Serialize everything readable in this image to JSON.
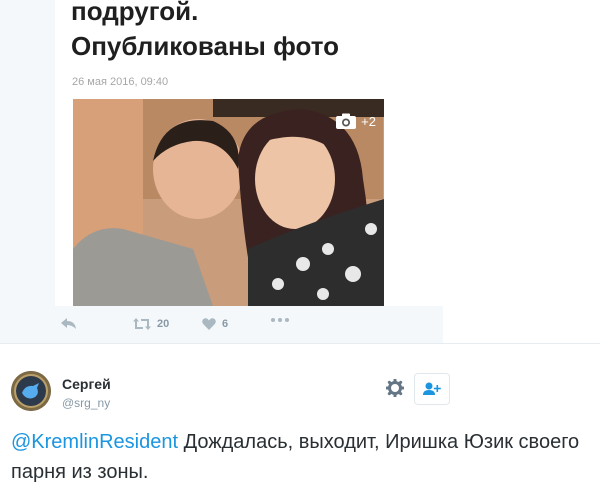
{
  "embed": {
    "headline_line1": "подругой.",
    "headline_line2": "Опубликованы фото",
    "date": "26 мая 2016, 09:40",
    "photo_count": "+2",
    "actions": {
      "retweets": "20",
      "likes": "6"
    }
  },
  "tweet": {
    "author_name": "Сергей",
    "author_handle": "@srg_ny",
    "mention": "@KremlinResident",
    "text": " Дождалась, выходит, Иришка Юзик своего парня из зоны."
  },
  "colors": {
    "link": "#1b95e0",
    "muted": "#8899a6",
    "embed_bg": "#f5f8fa"
  },
  "icons": [
    "reply-icon",
    "retweet-icon",
    "heart-icon",
    "more-icon",
    "camera-icon",
    "gear-icon",
    "follow-icon"
  ]
}
